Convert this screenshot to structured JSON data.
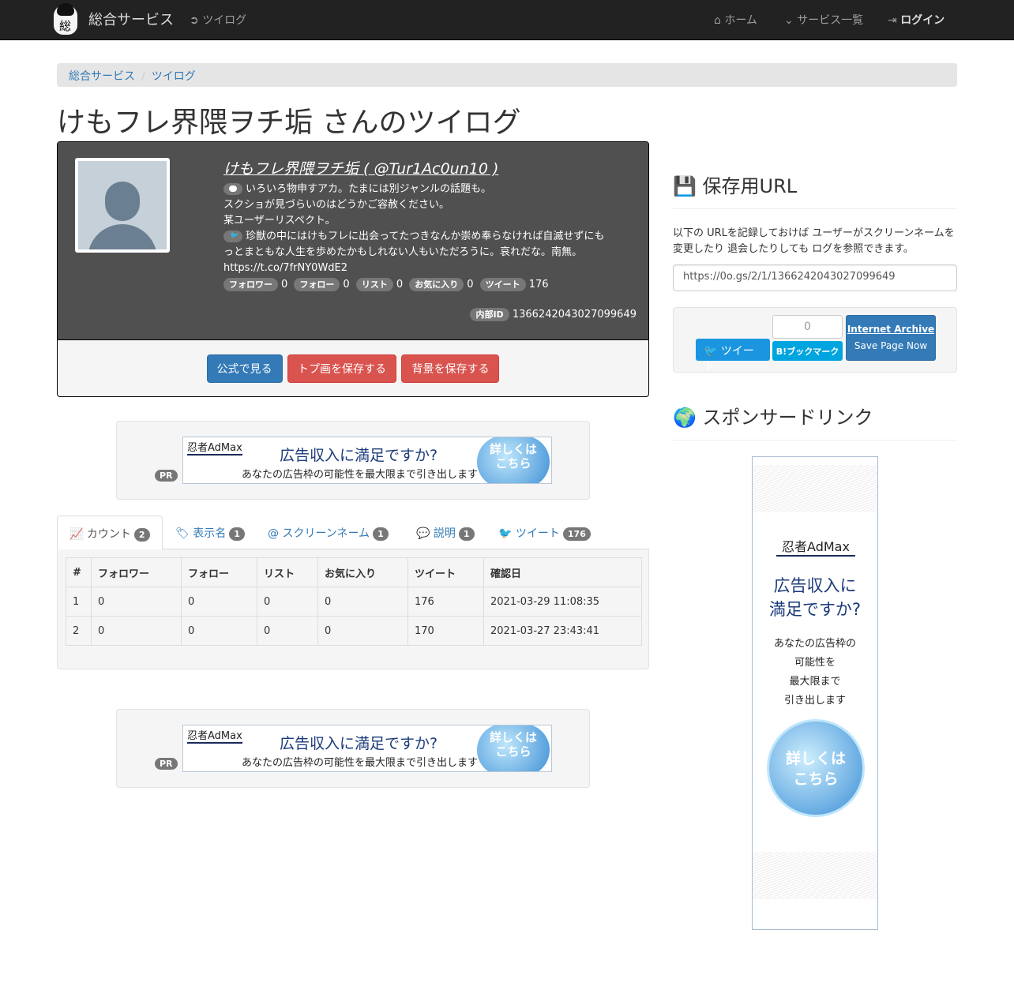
{
  "nav": {
    "brand": "総合サービス",
    "logo_char": "総",
    "twilog": "ツイログ",
    "home": "ホーム",
    "services": "サービス一覧",
    "login": "ログイン"
  },
  "breadcrumb": [
    "総合サービス",
    "ツイログ"
  ],
  "page_title": "けもフレ界隈ヲチ垢 さんのツイログ",
  "profile": {
    "name_line": "けもフレ界隈ヲチ垢 ( @Tur1Ac0un10 )",
    "desc": [
      "いろいろ物申すアカ。たまには別ジャンルの話題も。",
      "スクショが見づらいのはどうかご容赦ください。",
      "某ユーザーリスペクト。"
    ],
    "tweet_line1": "珍獣の中にはけもフレに出会ってたつきなんか崇め奉らなければ自滅せずにも",
    "tweet_line2": "っとまともな人生を歩めたかもしれない人もいただろうに。哀れだな。南無。",
    "tweet_url": "https://t.co/7frNY0WdE2",
    "stats": [
      {
        "label": "フォロワー",
        "value": "0"
      },
      {
        "label": "フォロー",
        "value": "0"
      },
      {
        "label": "リスト",
        "value": "0"
      },
      {
        "label": "お気に入り",
        "value": "0"
      },
      {
        "label": "ツイート",
        "value": "176"
      }
    ],
    "internal_label": "内部ID",
    "internal_id": "1366242043027099649",
    "buttons": [
      "公式で見る",
      "トプ画を保存する",
      "背景を保存する"
    ]
  },
  "ad_banner": {
    "brand": "忍者AdMax",
    "headline": "広告収入に満足ですか?",
    "sub": "あなたの広告枠の可能性を最大限まで引き出します",
    "cta1": "詳しくは",
    "cta2": "こちら",
    "pr": "PR"
  },
  "tabs": [
    {
      "label": "カウント",
      "count": "2"
    },
    {
      "label": "表示名",
      "count": "1"
    },
    {
      "label": "スクリーンネーム",
      "count": "1"
    },
    {
      "label": "説明",
      "count": "1"
    },
    {
      "label": "ツイート",
      "count": "176"
    }
  ],
  "table": {
    "headers": [
      "#",
      "フォロワー",
      "フォロー",
      "リスト",
      "お気に入り",
      "ツイート",
      "確認日"
    ],
    "rows": [
      [
        "1",
        "0",
        "0",
        "0",
        "0",
        "176",
        "2021-03-29 11:08:35"
      ],
      [
        "2",
        "0",
        "0",
        "0",
        "0",
        "170",
        "2021-03-27 23:43:41"
      ]
    ]
  },
  "save_url": {
    "title": "保存用URL",
    "help": "以下の URLを記録しておけば ユーザーがスクリーンネームを変更したり 退会したりしても ログを参照できます。",
    "url": "https://0o.gs/2/1/1366242043027099649",
    "tweet": "ツイート",
    "hatena_count": "0",
    "hatena": "B!ブックマーク",
    "ia_title": "Internet Archive",
    "ia_sub": "Save Page Now"
  },
  "sponsor": {
    "title": "スポンサードリンク",
    "brand": "忍者AdMax",
    "hl1": "広告収入に",
    "hl2": "満足ですか?",
    "sub": [
      "あなたの広告枠の",
      "可能性を",
      "最大限まで",
      "引き出します"
    ],
    "cta1": "詳しくは",
    "cta2": "こちら"
  }
}
